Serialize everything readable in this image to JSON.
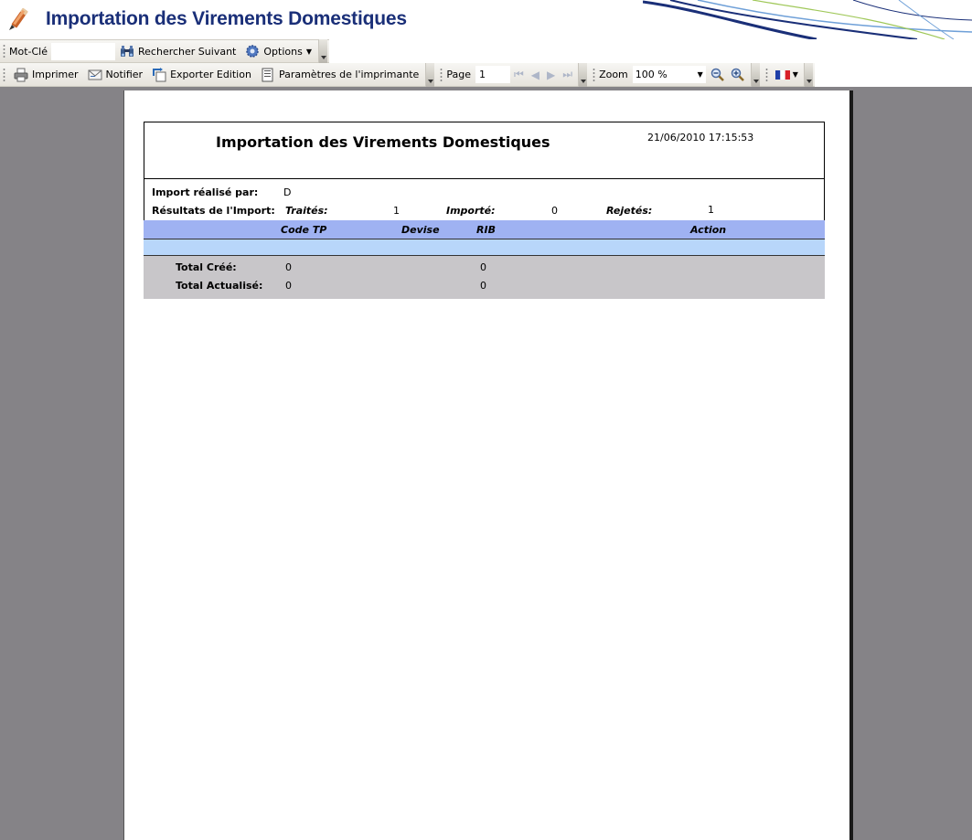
{
  "app": {
    "title": "Importation des Virements Domestiques"
  },
  "toolbar1": {
    "keyword_label": "Mot-Clé",
    "keyword_value": "",
    "find_next_label": "Rechercher Suivant",
    "options_label": "Options"
  },
  "toolbar2": {
    "print_label": "Imprimer",
    "notify_label": "Notifier",
    "export_label": "Exporter Edition",
    "printer_settings_label": "Paramètres de l'imprimante",
    "page_label": "Page",
    "page_value": "1",
    "zoom_label": "Zoom",
    "zoom_value": "100 %",
    "language": "fr"
  },
  "report": {
    "title": "Importation des Virements Domestiques",
    "datetime": "21/06/2010 17:15:53",
    "imported_by_label": "Import réalisé par:",
    "imported_by_value": "D",
    "results_label": "Résultats de l'Import:",
    "processed_label": "Traités:",
    "processed_value": "1",
    "imported_label": "Importé:",
    "imported_value": "0",
    "rejected_label": "Rejetés:",
    "rejected_value": "1",
    "columns": [
      "Code TP",
      "Devise",
      "RIB",
      "Action"
    ],
    "totals": [
      {
        "label": "Total Créé:",
        "a": "0",
        "b": "0"
      },
      {
        "label": "Total Actualisé:",
        "a": "0",
        "b": "0"
      }
    ]
  },
  "colors": {
    "title": "#1a2f78",
    "header_band": "#9fb2f2",
    "row_band": "#b8d6fa",
    "totals_band": "#c8c6c9",
    "viewer_bg": "#858387"
  }
}
